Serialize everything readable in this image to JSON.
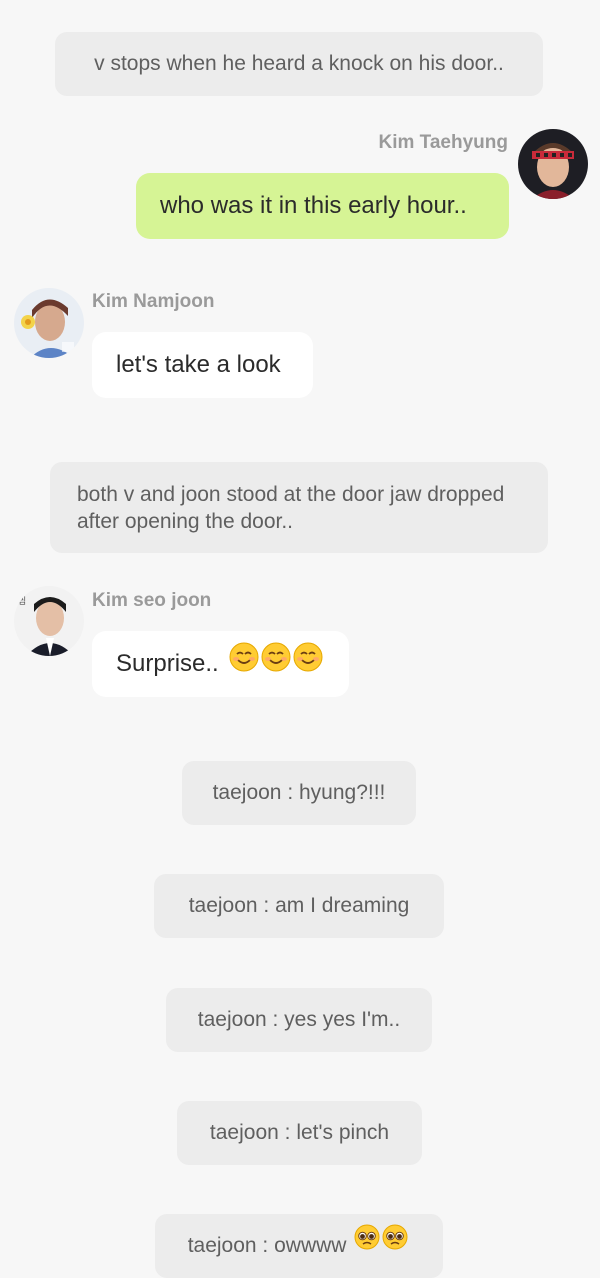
{
  "messages": [
    {
      "type": "narration",
      "text": "v stops when he heard a knock on his door.."
    },
    {
      "type": "chat",
      "sender": "Kim Taehyung",
      "side": "right",
      "text": "who was it in this early hour..",
      "avatar_icon": "taehyung-avatar"
    },
    {
      "type": "chat",
      "sender": "Kim Namjoon",
      "side": "left",
      "text": "let's take a look",
      "avatar_icon": "namjoon-avatar"
    },
    {
      "type": "narration",
      "text": "both v and joon stood at the door jaw dropped after opening the door.."
    },
    {
      "type": "chat",
      "sender": "Kim seo joon",
      "side": "left",
      "text": "Surprise..",
      "emoji": "smiling-face-emoji x3",
      "avatar_icon": "seojoon-avatar"
    },
    {
      "type": "narration",
      "text": "taejoon : hyung?!!!"
    },
    {
      "type": "narration",
      "text": "taejoon : am I dreaming"
    },
    {
      "type": "narration",
      "text": "taejoon : yes yes I'm.."
    },
    {
      "type": "narration",
      "text": "taejoon : let's pinch"
    },
    {
      "type": "narration",
      "text": "taejoon : owwww",
      "emoji": "pleading-face-emoji x2"
    }
  ],
  "colors": {
    "background": "#f7f7f7",
    "narration_bubble": "#ececec",
    "right_bubble": "#d6f495",
    "left_bubble": "#ffffff",
    "sender_name": "#9a9a9a"
  }
}
